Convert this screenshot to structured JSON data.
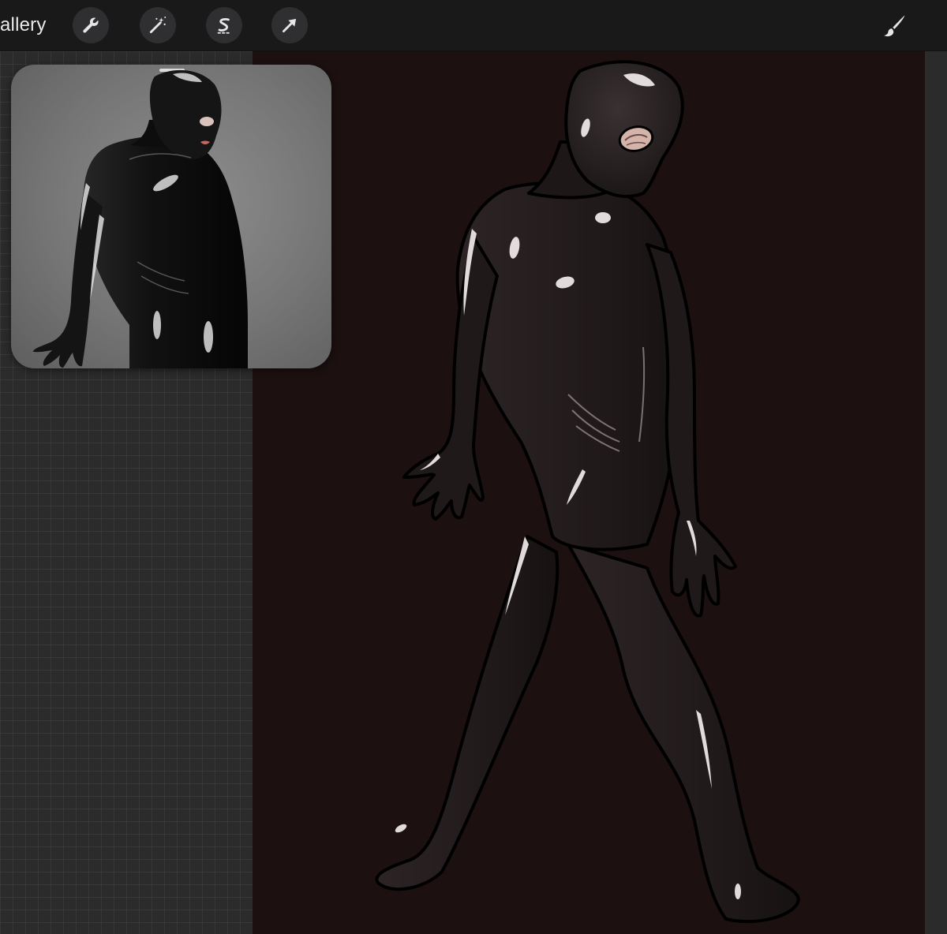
{
  "toolbar": {
    "gallery_label": "allery",
    "tools": [
      {
        "name": "actions",
        "icon": "wrench-icon"
      },
      {
        "name": "adjustments",
        "icon": "magic-wand-icon"
      },
      {
        "name": "selection",
        "icon": "selection-s-icon"
      },
      {
        "name": "transform",
        "icon": "arrow-cursor-icon"
      }
    ],
    "brush_icon": "brush-icon"
  },
  "reference": {
    "image_subject": "reference-photo-latex-figure"
  },
  "canvas": {
    "background_color": "#1c1010",
    "illustration_subject": "latex-figure-illustration"
  },
  "colors": {
    "toolbar_bg": "#191919",
    "button_bg": "#2f2f31",
    "icon_color": "#e6e6e6",
    "grid_bg": "#2b2b2c"
  }
}
